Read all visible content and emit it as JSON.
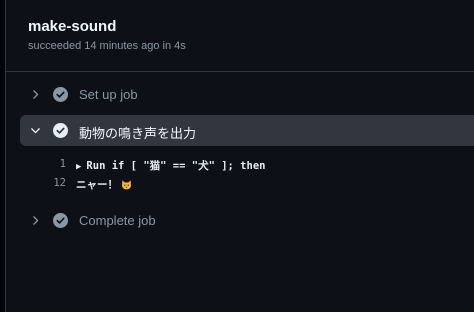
{
  "job": {
    "name": "make-sound",
    "status": "succeeded 14 minutes ago in 4s"
  },
  "steps": [
    {
      "label": "Set up job",
      "expanded": false,
      "status": "success"
    },
    {
      "label": "動物の鳴き声を出力",
      "expanded": true,
      "status": "success"
    },
    {
      "label": "Complete job",
      "expanded": false,
      "status": "success"
    }
  ],
  "log": [
    {
      "number": "1",
      "text": "Run if [ \"猫\" == \"犬\" ]; then",
      "collapsible": true
    },
    {
      "number": "12",
      "text": "ニャー！",
      "emoji": "cat-face-icon"
    }
  ],
  "colors": {
    "background": "#0d1117",
    "expanded_step_bg": "#31363f",
    "muted_text": "#8d96a0"
  }
}
